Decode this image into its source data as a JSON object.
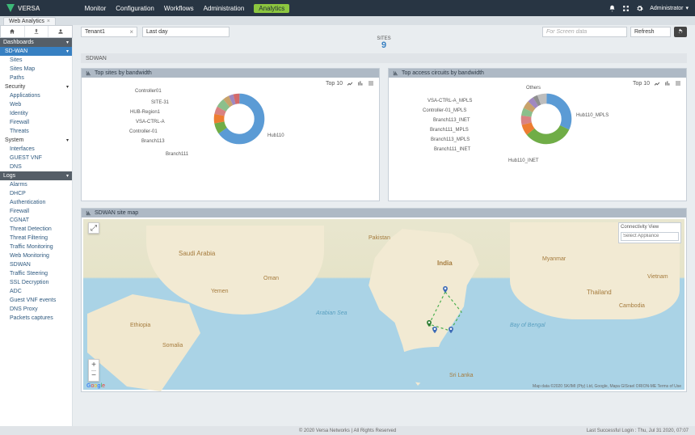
{
  "brand": "VERSA",
  "topnav": {
    "monitor": "Monitor",
    "configuration": "Configuration",
    "workflows": "Workflows",
    "administration": "Administration",
    "analytics": "Analytics"
  },
  "user_label": "Administrator",
  "subtab": {
    "label": "Web Analytics"
  },
  "filters": {
    "tenant": "Tenant1",
    "range": "Last day"
  },
  "search_placeholder": "For Screen data",
  "refresh_label": "Refresh",
  "sidebar": {
    "dashboards": "Dashboards",
    "sdwan": "SD-WAN",
    "sites": "Sites",
    "sites_map": "Sites Map",
    "paths": "Paths",
    "security": "Security",
    "applications": "Applications",
    "web": "Web",
    "identity": "Identity",
    "firewall": "Firewall",
    "threats": "Threats",
    "system": "System",
    "interfaces": "Interfaces",
    "guest_vnf": "GUEST VNF",
    "dns": "DNS",
    "logs": "Logs",
    "alarms": "Alarms",
    "dhcp": "DHCP",
    "authentication": "Authentication",
    "firewall2": "Firewall",
    "cgnat": "CGNAT",
    "threat_detection": "Threat Detection",
    "threat_filtering": "Threat Filtering",
    "traffic_monitoring": "Traffic Monitoring",
    "web_monitoring": "Web Monitoring",
    "sdwan2": "SDWAN",
    "traffic_steering": "Traffic Steering",
    "ssl_decryption": "SSL Decryption",
    "adc": "ADC",
    "guest_vnf_events": "Guest VNF events",
    "dns_proxy": "DNS Proxy",
    "packets_captures": "Packets captures"
  },
  "sites_badge": {
    "label": "SITES",
    "value": "9"
  },
  "crumb": "SDWAN",
  "panel_sites": {
    "title": "Top sites by bandwidth",
    "topn": "Top 10"
  },
  "panel_circuits": {
    "title": "Top access circuits by bandwidth",
    "topn": "Top 10"
  },
  "panel_map": {
    "title": "SDWAN site map"
  },
  "chart_data": [
    {
      "type": "pie",
      "title": "Top sites by bandwidth",
      "categories": [
        "Controller01",
        "SITE-31",
        "HUB-Region1",
        "VSA-CTRL-A",
        "Controller-01",
        "Branch113",
        "Branch111",
        "Hub110"
      ],
      "values": [
        4,
        3,
        4,
        6,
        5,
        6,
        7,
        65
      ],
      "labels": {
        "Controller01": "Controller01",
        "SITE-31": "SITE-31",
        "HUB-Region1": "HUB-Region1",
        "VSA-CTRL-A": "VSA-CTRL-A",
        "Controller-01": "Controller-01",
        "Branch113": "Branch113",
        "Branch111": "Branch111",
        "Hub110": "Hub110"
      }
    },
    {
      "type": "pie",
      "title": "Top access circuits by bandwidth",
      "categories": [
        "Others",
        "VSA-CTRL-A_MPLS",
        "Controller-01_MPLS",
        "Branch113_INET",
        "Branch111_MPLS",
        "Branch113_MPLS",
        "Branch111_INET",
        "Hub110_INET",
        "Hub110_MPLS"
      ],
      "values": [
        6,
        3,
        4,
        5,
        5,
        6,
        7,
        32,
        32
      ],
      "labels": {
        "Others": "Others",
        "VSA-CTRL-A_MPLS": "VSA-CTRL-A_MPLS",
        "Controller-01_MPLS": "Controller-01_MPLS",
        "Branch113_INET": "Branch113_INET",
        "Branch111_MPLS": "Branch111_MPLS",
        "Branch113_MPLS": "Branch113_MPLS",
        "Branch111_INET": "Branch111_INET",
        "Hub110_INET": "Hub110_INET",
        "Hub110_MPLS": "Hub110_MPLS"
      }
    }
  ],
  "map": {
    "legend_title": "Connectivity View",
    "legend_placeholder": "Select Appliance",
    "countries": {
      "saudi": "Saudi Arabia",
      "yemen": "Yemen",
      "oman": "Oman",
      "india": "India",
      "srilanka": "Sri Lanka",
      "thailand": "Thailand",
      "cambodia": "Cambodia",
      "vietnam": "Vietnam",
      "myanmar": "Myanmar",
      "pakistan": "Pakistan",
      "ethiopia": "Ethiopia",
      "somalia": "Somalia"
    },
    "seas": {
      "arabian": "Arabian Sea",
      "bengal": "Bay of Bengal"
    },
    "attribution": "Map data ©2020 SK/IMI (Pty) Ltd, Google, Mapa GISrael ORION-ME   Terms of Use",
    "google": "Google"
  },
  "footer": {
    "left": "",
    "mid": "© 2020 Versa Networks | All Rights Reserved",
    "right": "Last Successful Login : Thu, Jul 31 2020, 07:07"
  }
}
